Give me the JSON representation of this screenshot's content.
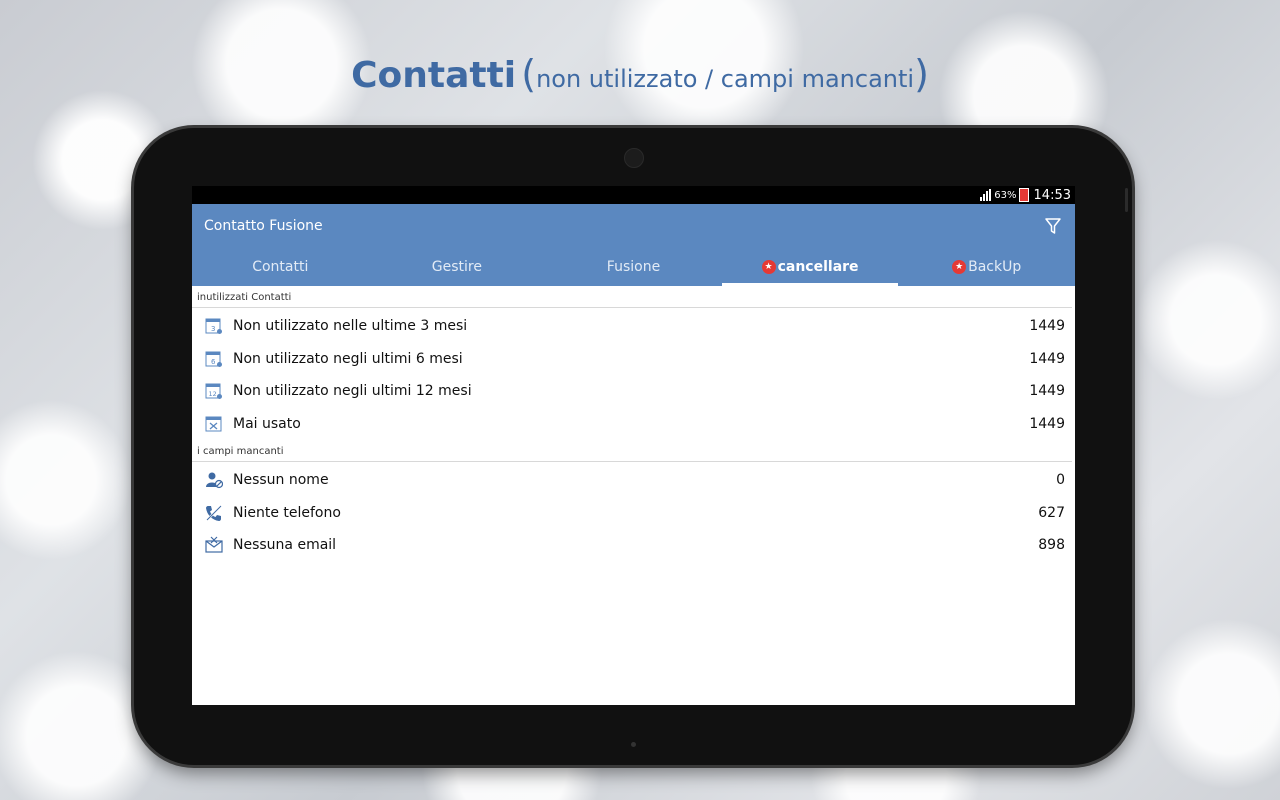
{
  "headline": {
    "main": "Contatti",
    "paren_open": "(",
    "sub": "non utilizzato / campi mancanti",
    "paren_close": ")"
  },
  "status_bar": {
    "battery": "63%",
    "time": "14:53"
  },
  "app": {
    "title": "Contatto Fusione",
    "filter_icon": "filter-icon"
  },
  "tabs": [
    {
      "label": "Contatti",
      "active": false
    },
    {
      "label": "Gestire",
      "active": false
    },
    {
      "label": "Fusione",
      "active": false
    },
    {
      "label": "cancellare",
      "active": true
    },
    {
      "label": "BackUp",
      "active": false
    }
  ],
  "sections": [
    {
      "header": "inutilizzati Contatti",
      "items": [
        {
          "icon": "calendar-3-icon",
          "label": "Non utilizzato nelle ultime 3 mesi",
          "count": "1449"
        },
        {
          "icon": "calendar-6-icon",
          "label": "Non utilizzato negli ultimi 6 mesi",
          "count": "1449"
        },
        {
          "icon": "calendar-12-icon",
          "label": "Non utilizzato negli ultimi 12 mesi",
          "count": "1449"
        },
        {
          "icon": "calendar-x-icon",
          "label": "Mai usato",
          "count": "1449"
        }
      ]
    },
    {
      "header": "i campi mancanti",
      "items": [
        {
          "icon": "no-name-icon",
          "label": "Nessun nome",
          "count": "0"
        },
        {
          "icon": "no-phone-icon",
          "label": "Niente telefono",
          "count": "627"
        },
        {
          "icon": "no-email-icon",
          "label": "Nessuna email",
          "count": "898"
        }
      ]
    }
  ],
  "colors": {
    "accent": "#5b88c0",
    "headline": "#3f6aa3",
    "badge": "#e53935"
  }
}
